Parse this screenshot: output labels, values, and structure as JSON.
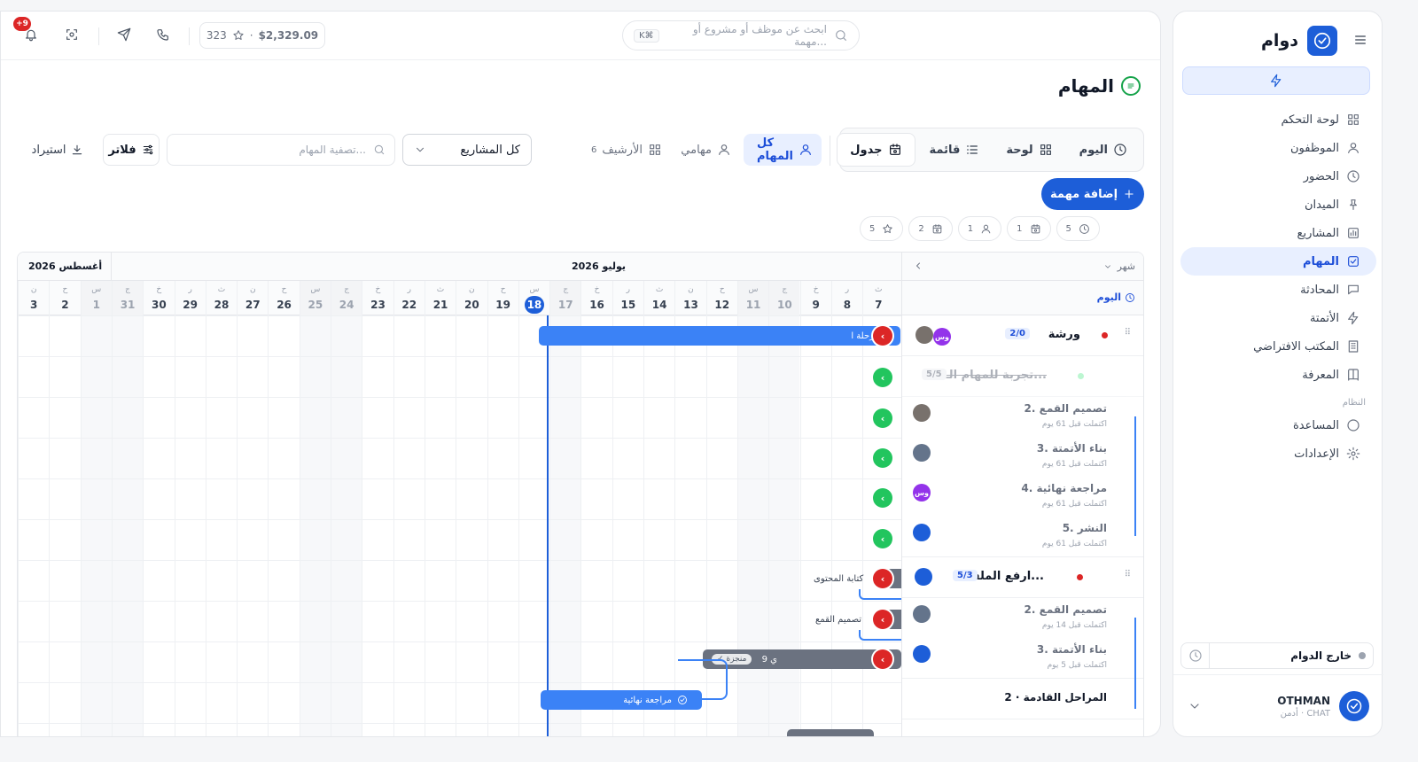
{
  "sidebar": {
    "brand": "دوام",
    "nav": [
      {
        "label": "لوحة التحكم",
        "icon": "grid-icon"
      },
      {
        "label": "الموظفون",
        "icon": "user-icon"
      },
      {
        "label": "الحضور",
        "icon": "clock-icon"
      },
      {
        "label": "الميدان",
        "icon": "pin-icon"
      },
      {
        "label": "المشاريع",
        "icon": "chart-icon"
      },
      {
        "label": "المهام",
        "icon": "check-square-icon",
        "active": true
      },
      {
        "label": "المحادثة",
        "icon": "chat-icon"
      },
      {
        "label": "الأتمتة",
        "icon": "bolt-icon"
      },
      {
        "label": "المكتب الافتراضي",
        "icon": "building-icon"
      },
      {
        "label": "المعرفة",
        "icon": "book-icon"
      }
    ],
    "system_section": "النظام",
    "system_nav": [
      {
        "label": "المساعدة",
        "icon": "help-icon"
      },
      {
        "label": "الإعدادات",
        "icon": "gear-icon"
      }
    ],
    "status": "خارج الدوام",
    "user": {
      "name": "OTHMAN",
      "role": "أدمن · CHAT"
    }
  },
  "topbar": {
    "notifications_badge": "+9",
    "wallet_amount": "$2,329.09",
    "wallet_points": "323",
    "search_placeholder": "ابحث عن موظف أو مشروع أو مهمة...",
    "search_shortcut": "K⌘"
  },
  "page": {
    "title": "المهام",
    "views": [
      {
        "label": "اليوم",
        "icon": "clock-icon"
      },
      {
        "label": "لوحة",
        "icon": "board-icon"
      },
      {
        "label": "قائمة",
        "icon": "list-icon"
      },
      {
        "label": "جدول",
        "icon": "calendar-icon",
        "active": true
      }
    ],
    "scopes": [
      {
        "label": "كل المهام",
        "active": true,
        "count": ""
      },
      {
        "label": "مهامي",
        "count": ""
      },
      {
        "label": "الأرشيف",
        "count": "6"
      }
    ],
    "project_select": "كل المشاريع",
    "filter_placeholder": "تصفية المهام...",
    "filter_button": "فلاتر",
    "import_button": "استيراد",
    "add_task_button": "إضافة مهمة",
    "chips": [
      "5",
      "1",
      "1",
      "2",
      "5"
    ]
  },
  "gantt": {
    "zoom_label": "شهر",
    "today_label": "اليوم",
    "months": [
      {
        "label": "يوليو 2026"
      },
      {
        "label": "أغسطس 2026"
      }
    ],
    "days": [
      {
        "wd": "ن",
        "d": "3"
      },
      {
        "wd": "ح",
        "d": "2"
      },
      {
        "wd": "س",
        "d": "1",
        "wk": true
      },
      {
        "wd": "ج",
        "d": "31",
        "wk": true
      },
      {
        "wd": "خ",
        "d": "30"
      },
      {
        "wd": "ر",
        "d": "29"
      },
      {
        "wd": "ث",
        "d": "28"
      },
      {
        "wd": "ن",
        "d": "27"
      },
      {
        "wd": "ح",
        "d": "26"
      },
      {
        "wd": "س",
        "d": "25",
        "wk": true
      },
      {
        "wd": "ج",
        "d": "24",
        "wk": true
      },
      {
        "wd": "خ",
        "d": "23"
      },
      {
        "wd": "ر",
        "d": "22"
      },
      {
        "wd": "ث",
        "d": "21"
      },
      {
        "wd": "ن",
        "d": "20"
      },
      {
        "wd": "ح",
        "d": "19"
      },
      {
        "wd": "س",
        "d": "18",
        "today": true
      },
      {
        "wd": "ج",
        "d": "17",
        "wk": true
      },
      {
        "wd": "خ",
        "d": "16"
      },
      {
        "wd": "ر",
        "d": "15"
      },
      {
        "wd": "ث",
        "d": "14"
      },
      {
        "wd": "ن",
        "d": "13"
      },
      {
        "wd": "ح",
        "d": "12"
      },
      {
        "wd": "س",
        "d": "11",
        "wk": true
      },
      {
        "wd": "ج",
        "d": "10",
        "wk": true
      },
      {
        "wd": "خ",
        "d": "9"
      },
      {
        "wd": "ر",
        "d": "8"
      },
      {
        "wd": "ث",
        "d": "7"
      }
    ],
    "bars": {
      "workshop_bar": "مرحلة ا",
      "content_label": "كتابة المحتوى",
      "design_label": "تصميم القمع",
      "gray_bar_text": "9 ي",
      "gray_bar_pill": "منجزة",
      "review_bar": "مراجعة نهائية"
    },
    "tasks": [
      {
        "title": "ورشة",
        "badge": "2/0"
      },
      {
        "title": "تجربة للمهام الـ...",
        "badge": "5/5"
      },
      {
        "title": "2. تصميم القمع",
        "meta": "اكتملت قبل 61 يوم"
      },
      {
        "title": "3. بناء الأتمتة",
        "meta": "اكتملت قبل 61 يوم"
      },
      {
        "title": "4. مراجعة نهائية",
        "meta": "اكتملت قبل 61 يوم",
        "avatar": "وس"
      },
      {
        "title": "5. النشر",
        "meta": "اكتملت قبل 61 يوم"
      },
      {
        "title": "ارفع الملف...",
        "badge": "5/3"
      },
      {
        "title": "2. تصميم القمع",
        "meta": "اكتملت قبل 14 يوم"
      },
      {
        "title": "3. بناء الأتمتة",
        "meta": "اكتملت قبل 5 يوم"
      },
      {
        "title": "المراحل القادمة · 2"
      }
    ],
    "workshop_avatar": "وس"
  },
  "colors": {
    "accent": "#1d5ed8",
    "danger": "#dc2626",
    "success": "#22c55e"
  }
}
